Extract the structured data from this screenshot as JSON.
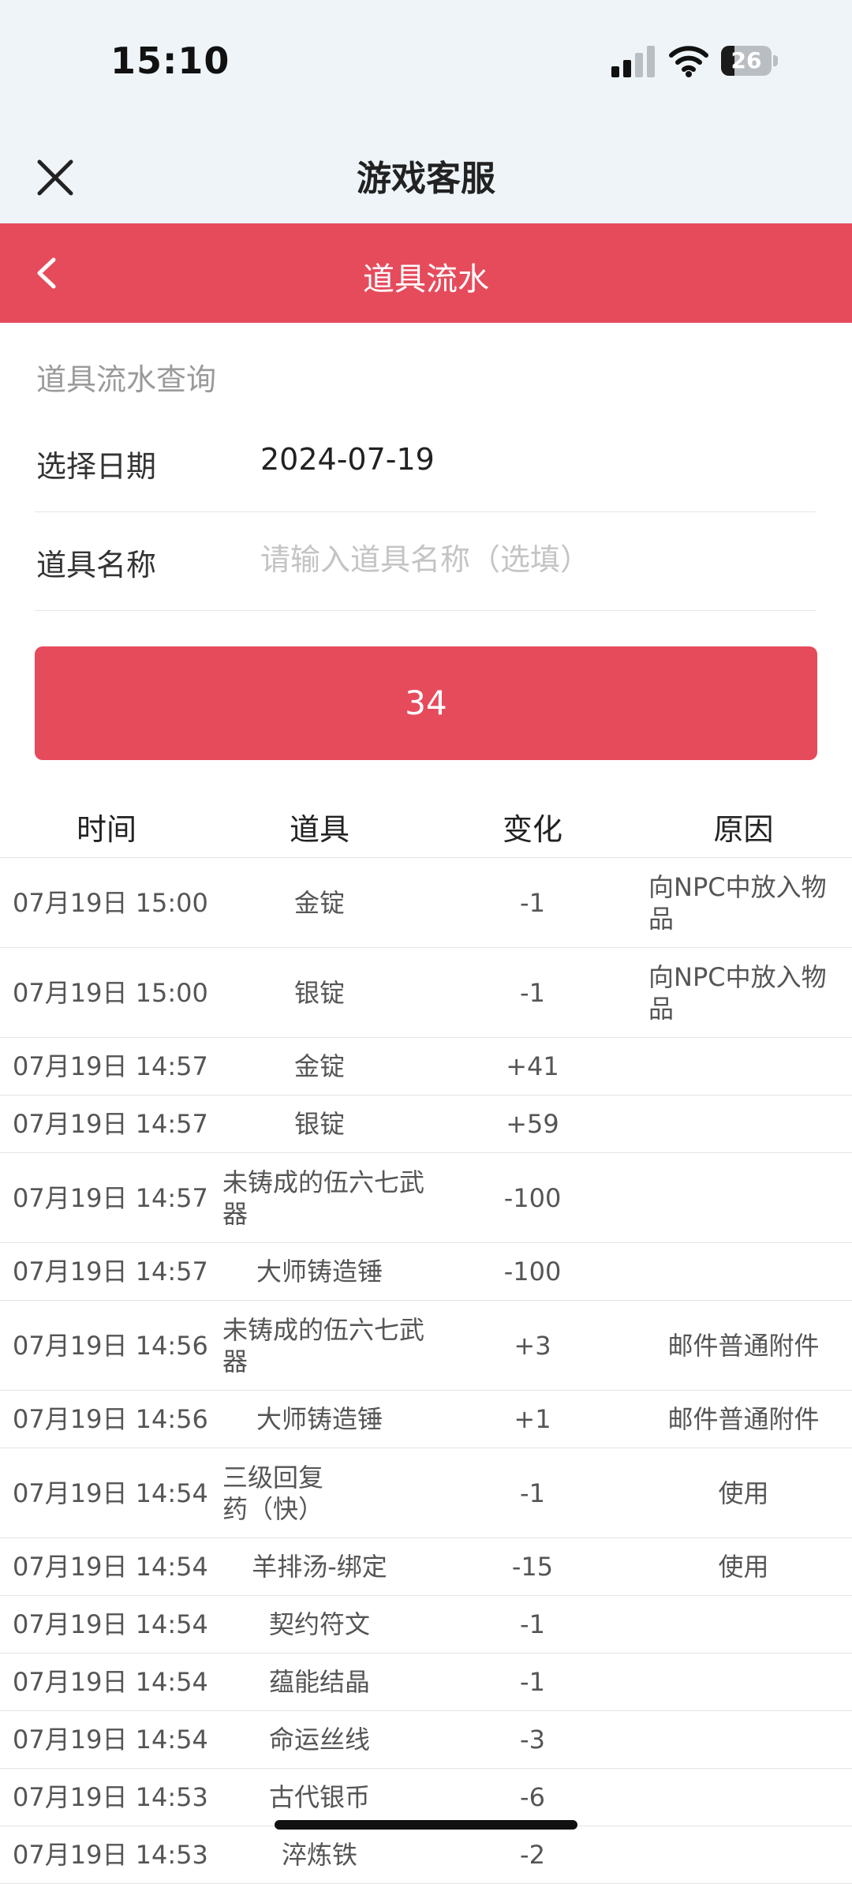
{
  "status_bar": {
    "time": "15:10",
    "battery": "26",
    "battery_level": 0.26
  },
  "app_bar": {
    "title": "游戏客服"
  },
  "header": {
    "title": "道具流水"
  },
  "form": {
    "section_title": "道具流水查询",
    "date_label": "选择日期",
    "date_value": "2024-07-19",
    "item_label": "道具名称",
    "item_placeholder": "请输入道具名称（选填）",
    "submit_label": "34"
  },
  "table": {
    "headers": [
      "时间",
      "道具",
      "变化",
      "原因"
    ],
    "rows": [
      {
        "time": "07月19日 15:00",
        "item": "金锭",
        "change": "-1",
        "reason": "向NPC中放入物品"
      },
      {
        "time": "07月19日 15:00",
        "item": "银锭",
        "change": "-1",
        "reason": "向NPC中放入物品"
      },
      {
        "time": "07月19日 14:57",
        "item": "金锭",
        "change": "+41",
        "reason": ""
      },
      {
        "time": "07月19日 14:57",
        "item": "银锭",
        "change": "+59",
        "reason": ""
      },
      {
        "time": "07月19日 14:57",
        "item": "未铸成的伍六七武器",
        "change": "-100",
        "reason": ""
      },
      {
        "time": "07月19日 14:57",
        "item": "大师铸造锤",
        "change": "-100",
        "reason": ""
      },
      {
        "time": "07月19日 14:56",
        "item": "未铸成的伍六七武器",
        "change": "+3",
        "reason": "邮件普通附件"
      },
      {
        "time": "07月19日 14:56",
        "item": "大师铸造锤",
        "change": "+1",
        "reason": "邮件普通附件"
      },
      {
        "time": "07月19日 14:54",
        "item": "三级回复药（快）",
        "change": "-1",
        "reason": "使用"
      },
      {
        "time": "07月19日 14:54",
        "item": "羊排汤-绑定",
        "change": "-15",
        "reason": "使用"
      },
      {
        "time": "07月19日 14:54",
        "item": "契约符文",
        "change": "-1",
        "reason": ""
      },
      {
        "time": "07月19日 14:54",
        "item": "蕴能结晶",
        "change": "-1",
        "reason": ""
      },
      {
        "time": "07月19日 14:54",
        "item": "命运丝线",
        "change": "-3",
        "reason": ""
      },
      {
        "time": "07月19日 14:53",
        "item": "古代银币",
        "change": "-6",
        "reason": ""
      },
      {
        "time": "07月19日 14:53",
        "item": "淬炼铁",
        "change": "-2",
        "reason": ""
      }
    ]
  },
  "colors": {
    "accent": "#e64b5c",
    "top_background": "#eef4f8"
  },
  "icons": {
    "close": "close-icon",
    "back": "chevron-left-icon",
    "signal": "signal-icon",
    "wifi": "wifi-icon",
    "battery": "battery-icon"
  }
}
